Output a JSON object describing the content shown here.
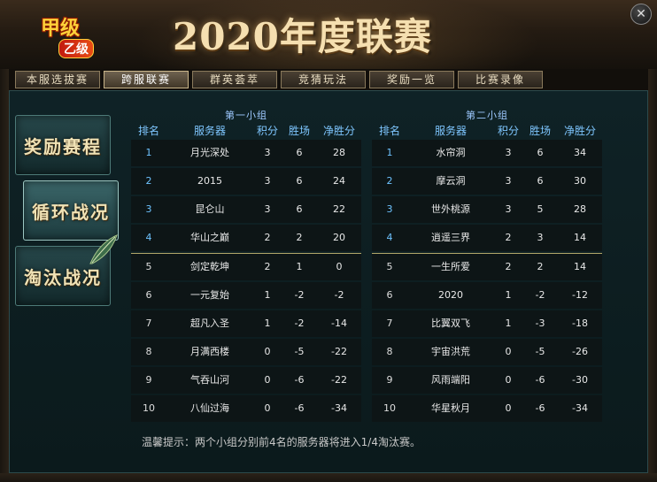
{
  "header": {
    "logo_main": "甲级",
    "logo_sub": "乙级",
    "title": "2020年度联赛"
  },
  "close_icon": "✕",
  "tabs": [
    {
      "label": "本服选拔赛",
      "active": false
    },
    {
      "label": "跨服联赛",
      "active": true
    },
    {
      "label": "群英荟萃",
      "active": false
    },
    {
      "label": "竞猜玩法",
      "active": false
    },
    {
      "label": "奖励一览",
      "active": false
    },
    {
      "label": "比赛录像",
      "active": false
    }
  ],
  "side_nav": [
    {
      "label": "奖励赛程",
      "active": false
    },
    {
      "label": "循环战况",
      "active": true
    },
    {
      "label": "淘汰战况",
      "active": false
    }
  ],
  "columns": {
    "rank": "排名",
    "server": "服务器",
    "points": "积分",
    "wins": "胜场",
    "net": "净胜分"
  },
  "groups": [
    {
      "title": "第一小组",
      "rows": [
        {
          "rank": "1",
          "server": "月光深处",
          "points": "3",
          "wins": "6",
          "net": "28"
        },
        {
          "rank": "2",
          "server": "2015",
          "points": "3",
          "wins": "6",
          "net": "24"
        },
        {
          "rank": "3",
          "server": "昆仑山",
          "points": "3",
          "wins": "6",
          "net": "22"
        },
        {
          "rank": "4",
          "server": "华山之巅",
          "points": "2",
          "wins": "2",
          "net": "20"
        },
        {
          "rank": "5",
          "server": "剑定乾坤",
          "points": "2",
          "wins": "1",
          "net": "0"
        },
        {
          "rank": "6",
          "server": "一元复始",
          "points": "1",
          "wins": "-2",
          "net": "-2"
        },
        {
          "rank": "7",
          "server": "超凡入圣",
          "points": "1",
          "wins": "-2",
          "net": "-14"
        },
        {
          "rank": "8",
          "server": "月满西楼",
          "points": "0",
          "wins": "-5",
          "net": "-22"
        },
        {
          "rank": "9",
          "server": "气吞山河",
          "points": "0",
          "wins": "-6",
          "net": "-22"
        },
        {
          "rank": "10",
          "server": "八仙过海",
          "points": "0",
          "wins": "-6",
          "net": "-34"
        }
      ]
    },
    {
      "title": "第二小组",
      "rows": [
        {
          "rank": "1",
          "server": "水帘洞",
          "points": "3",
          "wins": "6",
          "net": "34"
        },
        {
          "rank": "2",
          "server": "摩云洞",
          "points": "3",
          "wins": "6",
          "net": "30"
        },
        {
          "rank": "3",
          "server": "世外桃源",
          "points": "3",
          "wins": "5",
          "net": "28"
        },
        {
          "rank": "4",
          "server": "逍遥三界",
          "points": "2",
          "wins": "3",
          "net": "14"
        },
        {
          "rank": "5",
          "server": "一生所爱",
          "points": "2",
          "wins": "2",
          "net": "14"
        },
        {
          "rank": "6",
          "server": "2020",
          "points": "1",
          "wins": "-2",
          "net": "-12"
        },
        {
          "rank": "7",
          "server": "比翼双飞",
          "points": "1",
          "wins": "-3",
          "net": "-18"
        },
        {
          "rank": "8",
          "server": "宇宙洪荒",
          "points": "0",
          "wins": "-5",
          "net": "-26"
        },
        {
          "rank": "9",
          "server": "风雨端阳",
          "points": "0",
          "wins": "-6",
          "net": "-30"
        },
        {
          "rank": "10",
          "server": "华星秋月",
          "points": "0",
          "wins": "-6",
          "net": "-34"
        }
      ]
    }
  ],
  "tip": "温馨提示：两个小组分别前4名的服务器将进入1/4淘汰赛。"
}
